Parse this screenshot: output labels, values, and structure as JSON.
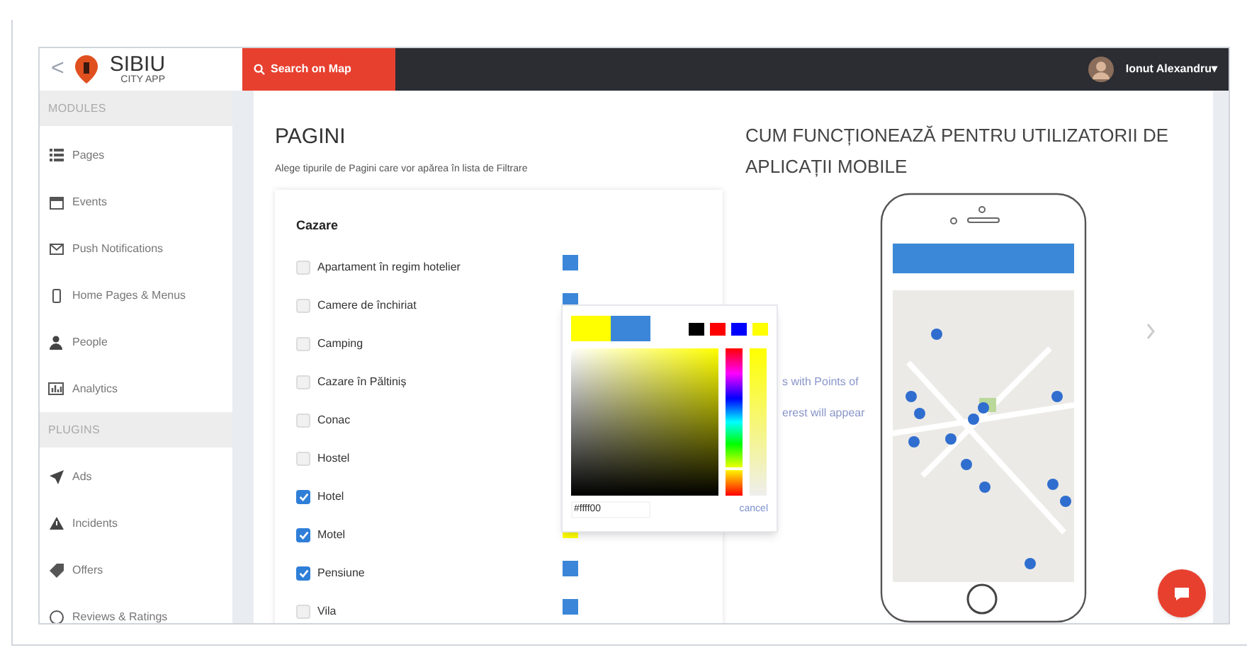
{
  "header": {
    "back": "<",
    "logo": {
      "title": "SIBIU",
      "subtitle": "CITY APP"
    },
    "search_button": "Search on Map",
    "user": {
      "name": "Ionut Alexandru",
      "caret": "▾"
    }
  },
  "sidebar": {
    "sections": [
      {
        "title": "MODULES",
        "items": [
          {
            "label": "Pages"
          },
          {
            "label": "Events"
          },
          {
            "label": "Push Notifications"
          },
          {
            "label": "Home Pages & Menus"
          },
          {
            "label": "People"
          },
          {
            "label": "Analytics"
          }
        ]
      },
      {
        "title": "PLUGINS",
        "items": [
          {
            "label": "Ads"
          },
          {
            "label": "Incidents"
          },
          {
            "label": "Offers"
          },
          {
            "label": "Reviews & Ratings"
          }
        ]
      }
    ]
  },
  "pages": {
    "title": "PAGINI",
    "subtitle": "Alege tipurile de Pagini care vor apărea în lista de Filtrare",
    "category": "Cazare",
    "items": [
      {
        "label": "Apartament în regim hotelier",
        "checked": false,
        "color": "#3b86d8"
      },
      {
        "label": "Camere de închiriat",
        "checked": false,
        "color": "#3b86d8"
      },
      {
        "label": "Camping",
        "checked": false
      },
      {
        "label": "Cazare în Păltiniș",
        "checked": false
      },
      {
        "label": "Conac",
        "checked": false
      },
      {
        "label": "Hostel",
        "checked": false
      },
      {
        "label": "Hotel",
        "checked": true
      },
      {
        "label": "Motel",
        "checked": true,
        "color": "#ffff00"
      },
      {
        "label": "Pensiune",
        "checked": true,
        "color": "#3b86d8"
      },
      {
        "label": "Vila",
        "checked": false,
        "color": "#3b86d8"
      }
    ]
  },
  "color_picker": {
    "swatches": [
      {
        "color": "#ffff00"
      },
      {
        "color": "#3b86d8"
      }
    ],
    "hue": {
      "level": 0.17
    },
    "alpha": {
      "level": 1
    },
    "presets": [
      {
        "color": "#000000"
      },
      {
        "color": "#ff0000"
      },
      {
        "color": "#0000ff"
      },
      {
        "color": "#ffff00"
      }
    ],
    "value": "#ffff00",
    "cancel": "cancel"
  },
  "howto": {
    "title": "CUM FUNCȚIONEAZĂ PENTRU UTILIZATORII DE APLICAȚII MOBILE",
    "lines": [
      "s with Points of",
      "erest will appear"
    ]
  }
}
